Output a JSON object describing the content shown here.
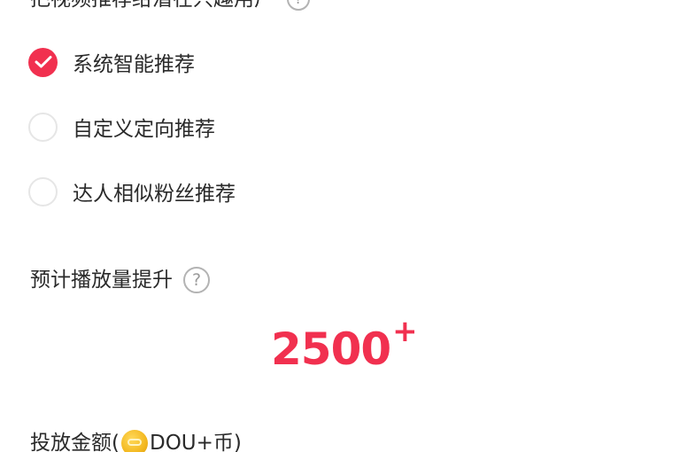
{
  "targeting": {
    "heading": "把视频推荐给潜在兴趣用户",
    "help_icon": "question-circle-icon",
    "options": [
      {
        "label": "系统智能推荐",
        "selected": true
      },
      {
        "label": "自定义定向推荐",
        "selected": false
      },
      {
        "label": "达人相似粉丝推荐",
        "selected": false
      }
    ]
  },
  "estimate": {
    "label": "预计播放量提升",
    "help_icon": "question-circle-icon",
    "value": "2500",
    "suffix": "+"
  },
  "amount": {
    "label_prefix": "投放金额(",
    "coin_icon": "dou-coin-icon",
    "label_suffix": "DOU+币)"
  },
  "colors": {
    "accent": "#f1304f",
    "text": "#2a2a2a",
    "radio_border": "#e6e6e6",
    "help_icon": "#b3b3b3"
  }
}
